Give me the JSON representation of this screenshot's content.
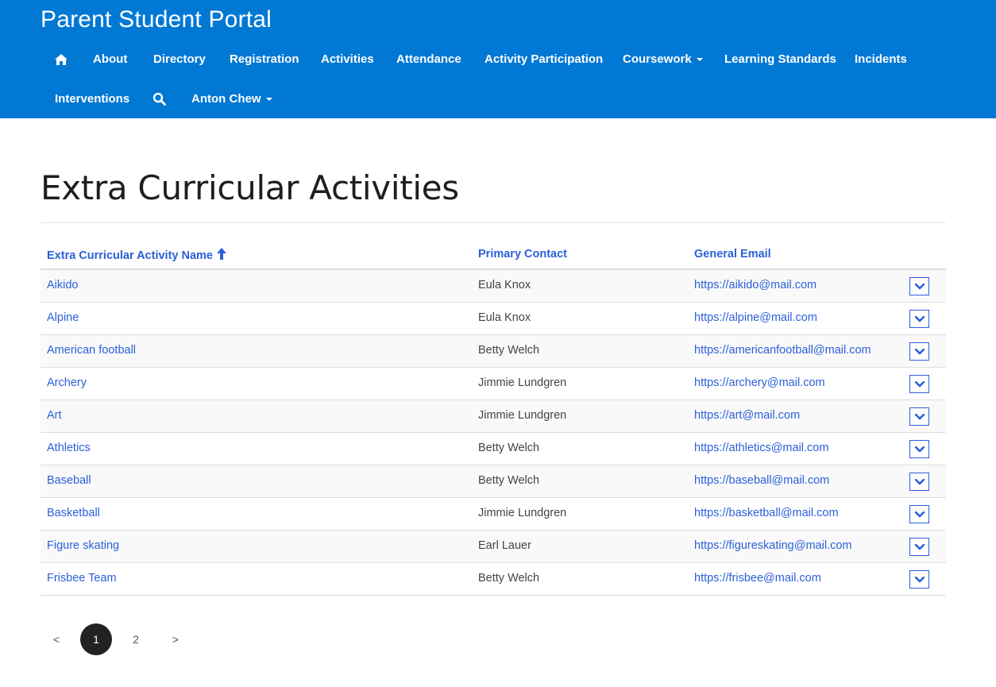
{
  "app": {
    "title": "Parent Student Portal"
  },
  "nav": {
    "home_icon": "home-icon",
    "items": [
      {
        "label": "About"
      },
      {
        "label": "Directory"
      },
      {
        "label": "Registration"
      },
      {
        "label": "Activities"
      },
      {
        "label": "Attendance"
      },
      {
        "label": "Activity Participation"
      },
      {
        "label": "Coursework",
        "dropdown": true
      },
      {
        "label": "Learning Standards"
      },
      {
        "label": "Incidents"
      },
      {
        "label": "Interventions"
      }
    ],
    "search_icon": "search-icon",
    "user": {
      "label": "Anton Chew",
      "dropdown": true
    }
  },
  "page": {
    "title": "Extra Curricular Activities"
  },
  "table": {
    "columns": [
      {
        "label": "Extra Curricular Activity Name",
        "sorted": "ascending"
      },
      {
        "label": "Primary Contact"
      },
      {
        "label": "General Email"
      }
    ],
    "rows": [
      {
        "name": "Aikido",
        "contact": "Eula Knox",
        "email": "https://aikido@mail.com"
      },
      {
        "name": "Alpine",
        "contact": "Eula Knox",
        "email": "https://alpine@mail.com"
      },
      {
        "name": "American football",
        "contact": "Betty Welch",
        "email": "https://americanfootball@mail.com"
      },
      {
        "name": "Archery",
        "contact": "Jimmie Lundgren",
        "email": "https://archery@mail.com"
      },
      {
        "name": "Art",
        "contact": "Jimmie Lundgren",
        "email": "https://art@mail.com"
      },
      {
        "name": "Athletics",
        "contact": "Betty Welch",
        "email": "https://athletics@mail.com"
      },
      {
        "name": "Baseball",
        "contact": "Betty Welch",
        "email": "https://baseball@mail.com"
      },
      {
        "name": "Basketball",
        "contact": "Jimmie Lundgren",
        "email": "https://basketball@mail.com"
      },
      {
        "name": "Figure skating",
        "contact": "Earl Lauer",
        "email": "https://figureskating@mail.com"
      },
      {
        "name": "Frisbee Team",
        "contact": "Betty Welch",
        "email": "https://frisbee@mail.com"
      }
    ]
  },
  "pagination": {
    "prev": "<",
    "pages": [
      "1",
      "2"
    ],
    "current": "1",
    "next": ">"
  },
  "colors": {
    "header_bg": "#0078d4",
    "link": "#2b5fd9",
    "active_page": "#222222"
  }
}
